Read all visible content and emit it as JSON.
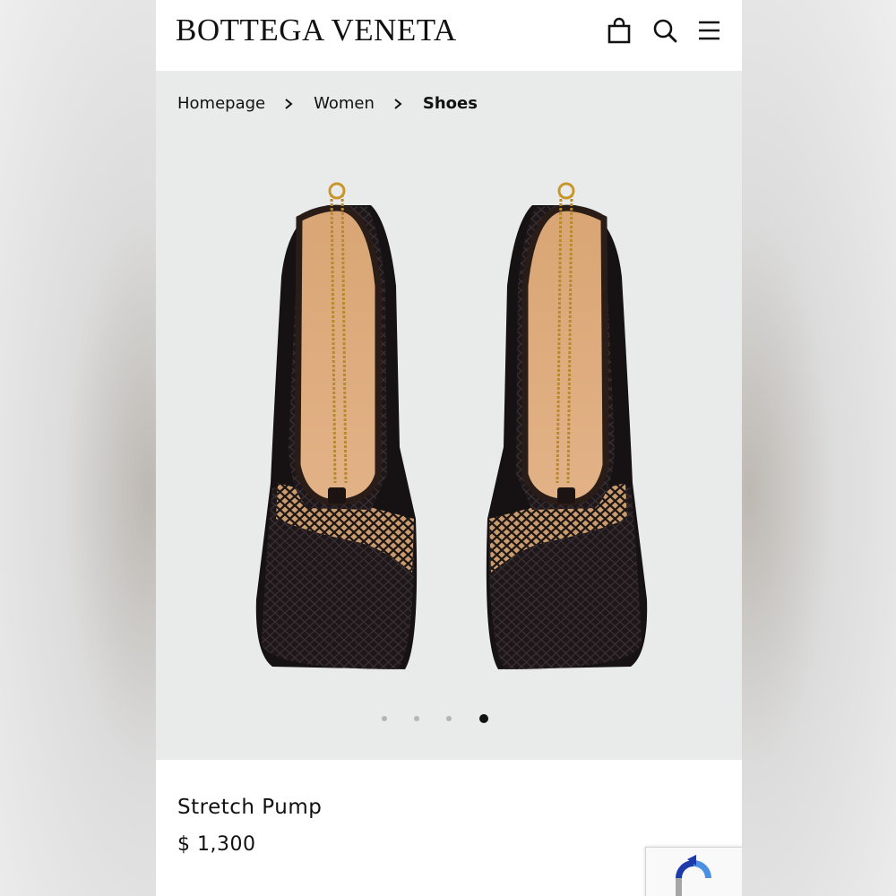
{
  "header": {
    "brand": "BOTTEGA VENETA",
    "icons": [
      "shopping-bag-icon",
      "search-icon",
      "menu-icon"
    ]
  },
  "breadcrumb": {
    "items": [
      "Homepage",
      "Women",
      "Shoes"
    ]
  },
  "gallery": {
    "image_count": 4,
    "active_index": 3,
    "background": "#e9ebea"
  },
  "product": {
    "name": "Stretch Pump",
    "price": "$ 1,300"
  },
  "colors": {
    "text": "#111111",
    "page": "#ffffff",
    "dot_inactive": "#b4b6b5",
    "dot_active": "#111111"
  }
}
